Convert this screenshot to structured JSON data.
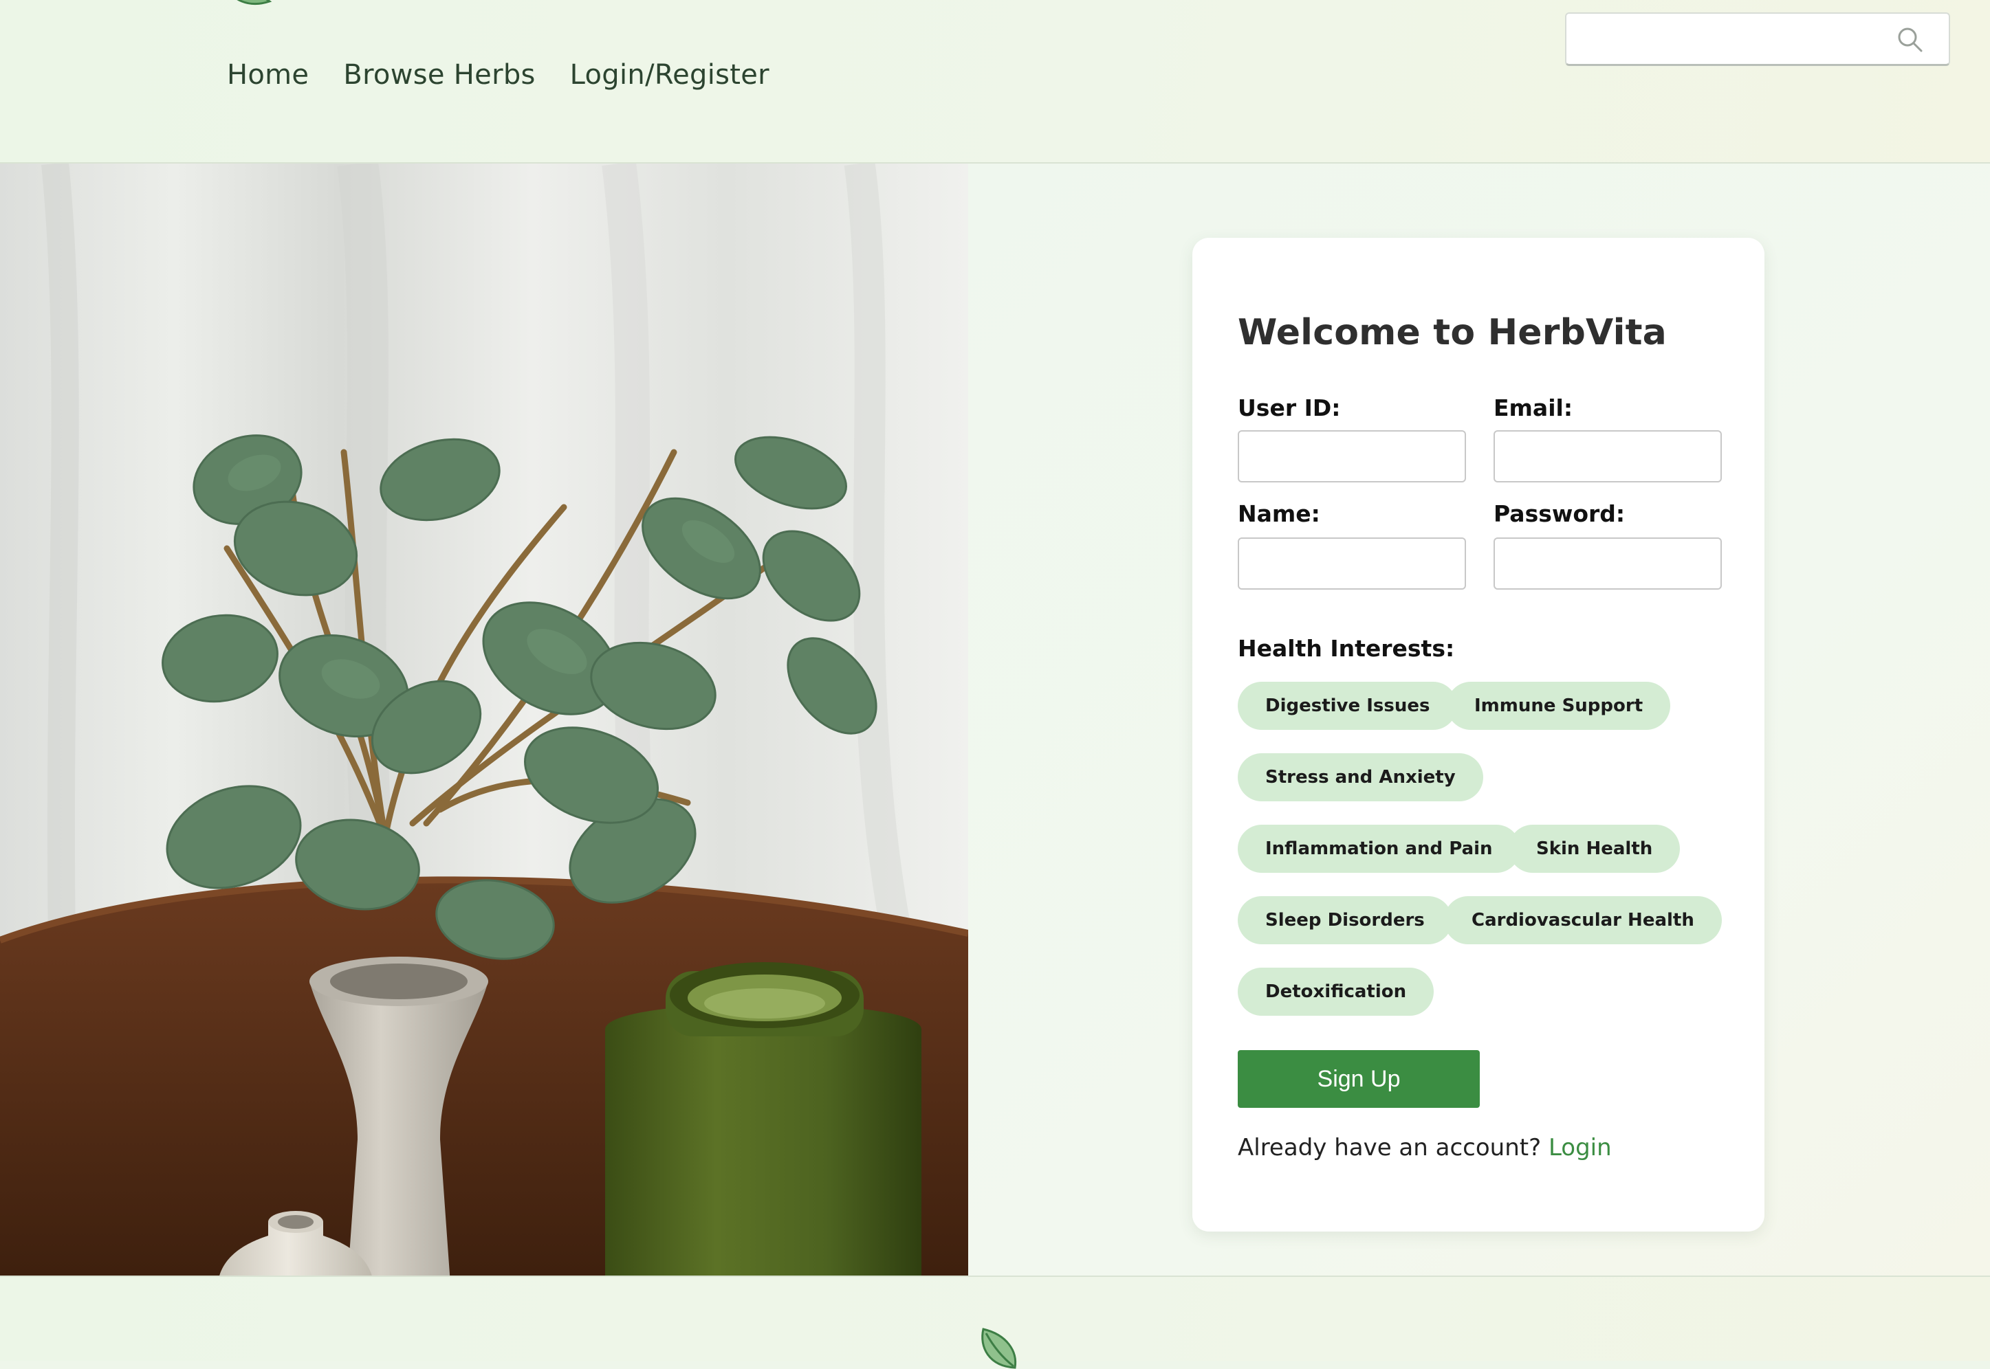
{
  "header": {
    "nav": [
      "Home",
      "Browse Herbs",
      "Login/Register"
    ],
    "search": {
      "placeholder": "",
      "value": ""
    }
  },
  "card": {
    "title": "Welcome to HerbVita",
    "fields": {
      "user_id": {
        "label": "User ID:",
        "value": ""
      },
      "email": {
        "label": "Email:",
        "value": ""
      },
      "name": {
        "label": "Name:",
        "value": ""
      },
      "password": {
        "label": "Password:",
        "value": ""
      }
    },
    "interests_label": "Health Interests:",
    "interests": [
      "Digestive Issues",
      "Immune Support",
      "Stress and Anxiety",
      "Inflammation and Pain",
      "Skin Health",
      "Sleep Disorders",
      "Cardiovascular Health",
      "Detoxification"
    ],
    "signup_label": "Sign Up",
    "login_prompt": "Already have an account?",
    "login_link": "Login"
  },
  "colors": {
    "accent": "#3b8d42",
    "chip": "#d4ecd3",
    "header_bg": "#eef6e9"
  },
  "icons": {
    "logo": "leaf-icon",
    "search": "search-icon",
    "footer": "leaf-icon"
  }
}
